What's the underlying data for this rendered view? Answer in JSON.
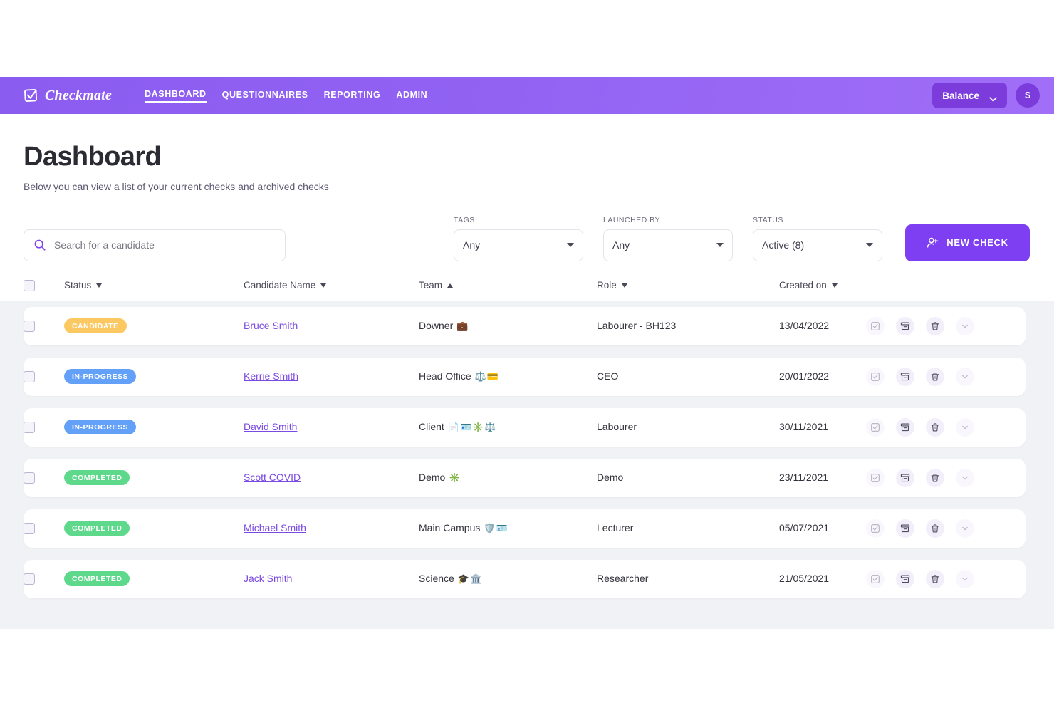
{
  "brand": {
    "name": "Checkmate",
    "logo_icon": "check-square-logo-icon"
  },
  "nav": {
    "links": [
      {
        "label": "DASHBOARD",
        "active": true
      },
      {
        "label": "QUESTIONNAIRES",
        "active": false
      },
      {
        "label": "REPORTING",
        "active": false
      },
      {
        "label": "ADMIN",
        "active": false
      }
    ],
    "balance_label": "Balance",
    "balance_chevron_icon": "chevron-down-icon",
    "avatar_initial": "S"
  },
  "header": {
    "title": "Dashboard",
    "subtitle": "Below you can view a list of your current checks and archived checks"
  },
  "search": {
    "placeholder": "Search for a candidate",
    "value": "",
    "icon": "search-icon"
  },
  "filters": [
    {
      "label": "TAGS",
      "value": "Any"
    },
    {
      "label": "LAUNCHED BY",
      "value": "Any"
    },
    {
      "label": "STATUS",
      "value": "Active (8)"
    }
  ],
  "new_check_button": {
    "label": "NEW CHECK",
    "icon": "user-plus-icon"
  },
  "table": {
    "columns": [
      {
        "label": "Status",
        "sort": "down"
      },
      {
        "label": "Candidate Name",
        "sort": "down"
      },
      {
        "label": "Team",
        "sort": "up"
      },
      {
        "label": "Role",
        "sort": "down"
      },
      {
        "label": "Created on",
        "sort": "down"
      }
    ],
    "row_actions": [
      {
        "name": "complete-check-button",
        "icon": "check-square-icon",
        "dimmed": true
      },
      {
        "name": "archive-check-button",
        "icon": "archive-icon",
        "dimmed": false
      },
      {
        "name": "delete-check-button",
        "icon": "trash-icon",
        "dimmed": false
      },
      {
        "name": "expand-row-button",
        "icon": "chevron-down-icon",
        "dimmed": true
      }
    ],
    "rows": [
      {
        "status": "CANDIDATE",
        "status_color": "#fbc862",
        "name": "Bruce Smith",
        "team": "Downer",
        "team_emoji": "💼",
        "role": "Labourer - BH123",
        "created_on": "13/04/2022"
      },
      {
        "status": "IN-PROGRESS",
        "status_color": "#63a0f7",
        "name": "Kerrie Smith",
        "team": "Head Office",
        "team_emoji": "⚖️💳",
        "role": "CEO",
        "created_on": "20/01/2022"
      },
      {
        "status": "IN-PROGRESS",
        "status_color": "#63a0f7",
        "name": "David Smith",
        "team": "Client",
        "team_emoji": "📄🪪✳️⚖️",
        "role": "Labourer",
        "created_on": "30/11/2021"
      },
      {
        "status": "COMPLETED",
        "status_color": "#5ed98c",
        "name": "Scott COVID",
        "team": "Demo",
        "team_emoji": "✳️",
        "role": "Demo",
        "created_on": "23/11/2021"
      },
      {
        "status": "COMPLETED",
        "status_color": "#5ed98c",
        "name": "Michael Smith",
        "team": "Main Campus",
        "team_emoji": "🛡️🪪",
        "role": "Lecturer",
        "created_on": "05/07/2021"
      },
      {
        "status": "COMPLETED",
        "status_color": "#5ed98c",
        "name": "Jack Smith",
        "team": "Science",
        "team_emoji": "🎓🏛️",
        "role": "Researcher",
        "created_on": "21/05/2021"
      }
    ]
  },
  "theme": {
    "nav_gradient_start": "#8b5cf0",
    "nav_gradient_end": "#a06ef7",
    "accent": "#7e3ff2",
    "link": "#7b4ae2",
    "table_bg": "#f1f2f5"
  }
}
